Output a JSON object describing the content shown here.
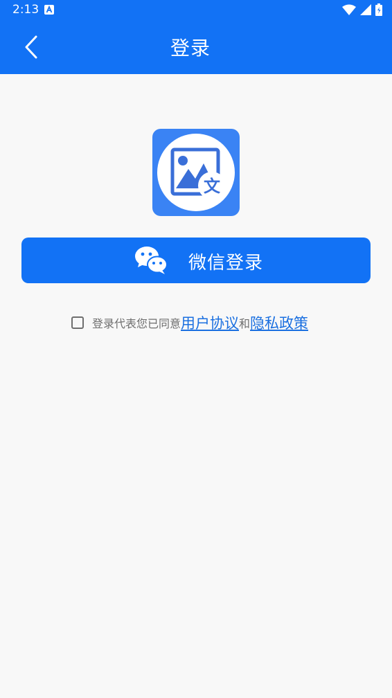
{
  "status_bar": {
    "time": "2:13",
    "icons": [
      "a-notification-icon",
      "wifi-icon",
      "signal-icon",
      "battery-icon"
    ]
  },
  "header": {
    "title": "登录",
    "back_icon": "chevron-left-icon"
  },
  "logo": {
    "icon": "image-translate-icon",
    "badge_char": "文"
  },
  "login": {
    "wechat_label": "微信登录",
    "wechat_icon": "wechat-icon"
  },
  "agreement": {
    "prefix": "登录代表您已同意",
    "user_agreement": "用户协议",
    "conjunction": "和",
    "privacy_policy": "隐私政策",
    "checked": false
  },
  "colors": {
    "primary": "#1272f5",
    "background": "#f8f8f8",
    "link": "#1a6fe0",
    "muted_text": "#6e6e6e"
  }
}
